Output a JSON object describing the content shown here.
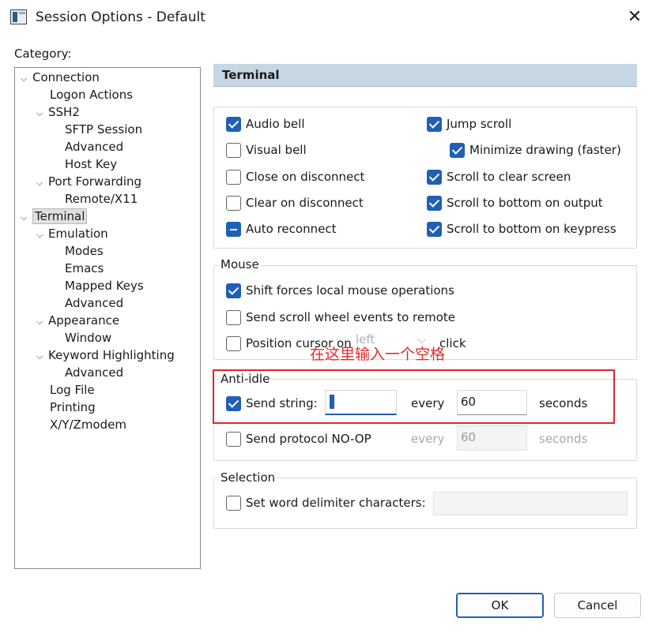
{
  "window": {
    "title": "Session Options - Default",
    "close_glyph": "✕"
  },
  "category_label": "Category:",
  "tree": [
    {
      "label": "Connection",
      "expanded": true
    },
    {
      "label": "Logon Actions"
    },
    {
      "label": "SSH2",
      "expanded": true
    },
    {
      "label": "SFTP Session"
    },
    {
      "label": "Advanced"
    },
    {
      "label": "Host Key"
    },
    {
      "label": "Port Forwarding",
      "expanded": true
    },
    {
      "label": "Remote/X11"
    },
    {
      "label": "Terminal",
      "expanded": true,
      "selected": true
    },
    {
      "label": "Emulation",
      "expanded": true
    },
    {
      "label": "Modes"
    },
    {
      "label": "Emacs"
    },
    {
      "label": "Mapped Keys"
    },
    {
      "label": "Advanced"
    },
    {
      "label": "Appearance",
      "expanded": true
    },
    {
      "label": "Window"
    },
    {
      "label": "Keyword Highlighting",
      "expanded": true
    },
    {
      "label": "Advanced"
    },
    {
      "label": "Log File"
    },
    {
      "label": "Printing"
    },
    {
      "label": "X/Y/Zmodem"
    }
  ],
  "section_title": "Terminal",
  "terminal_options": {
    "audio_bell": {
      "label": "Audio bell",
      "state": "checked"
    },
    "visual_bell": {
      "label": "Visual bell",
      "state": "unchecked"
    },
    "close_on_disconnect": {
      "label": "Close on disconnect",
      "state": "unchecked"
    },
    "clear_on_disconnect": {
      "label": "Clear on disconnect",
      "state": "unchecked"
    },
    "auto_reconnect": {
      "label": "Auto reconnect",
      "state": "indeterminate"
    },
    "jump_scroll": {
      "label": "Jump scroll",
      "state": "checked"
    },
    "minimize_drawing": {
      "label": "Minimize drawing (faster)",
      "state": "checked"
    },
    "scroll_to_clear": {
      "label": "Scroll to clear screen",
      "state": "checked"
    },
    "scroll_bottom_output": {
      "label": "Scroll to bottom on output",
      "state": "checked"
    },
    "scroll_bottom_keypress": {
      "label": "Scroll to bottom on keypress",
      "state": "checked"
    }
  },
  "mouse": {
    "title": "Mouse",
    "shift_forces": {
      "label": "Shift forces local mouse operations",
      "state": "checked"
    },
    "send_scroll": {
      "label": "Send scroll wheel events to remote",
      "state": "unchecked"
    },
    "position_cursor": {
      "label": "Position cursor on",
      "state": "unchecked",
      "dropdown_value": "left",
      "suffix": "click"
    }
  },
  "annotation": "在这里输入一个空格",
  "anti_idle": {
    "title": "Anti-idle",
    "send_string": {
      "label": "Send string:",
      "state": "checked",
      "value": "",
      "every": "every",
      "seconds_value": "60",
      "seconds": "seconds"
    },
    "send_noop": {
      "label": "Send protocol NO-OP",
      "state": "unchecked",
      "every": "every",
      "seconds_value": "60",
      "seconds": "seconds"
    }
  },
  "selection": {
    "title": "Selection",
    "word_delim": {
      "label": "Set word delimiter characters:",
      "state": "unchecked",
      "value": ""
    }
  },
  "buttons": {
    "ok": "OK",
    "cancel": "Cancel"
  },
  "colors": {
    "accent": "#1f5fb6",
    "header_bg": "#c7d6e3",
    "annotation": "#e0262f"
  }
}
